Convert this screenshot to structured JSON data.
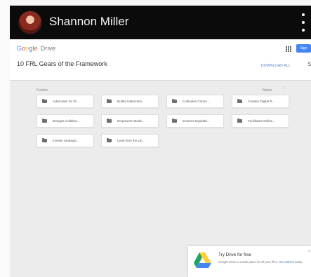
{
  "window": {
    "title_user": "Shannon Miller"
  },
  "drive": {
    "brand_google": "Google",
    "brand_product": "Drive",
    "folder_title": "10 FRL Gears of the Framework",
    "signin_label": "Sign",
    "download_all": "DOWNLOAD ALL",
    "more_label": "S"
  },
  "list": {
    "section_label": "Folders",
    "sort_label": "Name",
    "sort_arrow": "↑"
  },
  "folders": [
    "Advocates for St...",
    "Builds Instruction...",
    "Cultivates Comm...",
    "Curates Digital R...",
    "Designs Collabor...",
    "Empowers Stude...",
    "Ensures Equitabl...",
    "Facilitates Online...",
    "Invests Strategic...",
    "Lead from the Lib..."
  ],
  "promo": {
    "title": "Try Drive for free",
    "body_prefix": "Google Drive is a safe place for all your files.",
    "body_link": "Get started",
    "body_suffix": " today.",
    "close": "×"
  },
  "icons": {
    "kebab": "more-vert-icon",
    "apps": "apps-grid-icon",
    "folder": "folder-icon",
    "drive_logo": "google-drive-logo-icon"
  },
  "colors": {
    "titlebar": "#0b0b0b",
    "accent": "#4285f4",
    "download_link": "#5b7fc7"
  }
}
